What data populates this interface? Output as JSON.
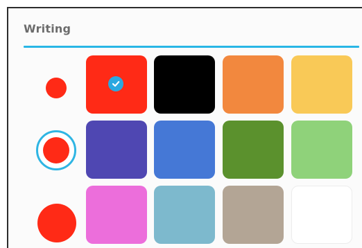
{
  "panel": {
    "title": "Writing"
  },
  "colors": {
    "accent": "#29b6e6",
    "selected_brush": "#ff2a16"
  },
  "brush_sizes": [
    {
      "name": "small",
      "selected": false
    },
    {
      "name": "medium",
      "selected": true
    },
    {
      "name": "large",
      "selected": false
    }
  ],
  "swatches": [
    {
      "name": "red",
      "color": "#ff2a16",
      "selected": true
    },
    {
      "name": "black",
      "color": "#000000",
      "selected": false
    },
    {
      "name": "orange",
      "color": "#f2883e",
      "selected": false
    },
    {
      "name": "yellow",
      "color": "#f9c957",
      "selected": false
    },
    {
      "name": "indigo",
      "color": "#4f47b2",
      "selected": false
    },
    {
      "name": "blue",
      "color": "#4578d6",
      "selected": false
    },
    {
      "name": "green",
      "color": "#5b912d",
      "selected": false
    },
    {
      "name": "light-green",
      "color": "#8fd27a",
      "selected": false
    },
    {
      "name": "pink",
      "color": "#ec6edb",
      "selected": false
    },
    {
      "name": "light-blue",
      "color": "#7db9cd",
      "selected": false
    },
    {
      "name": "taupe",
      "color": "#b3a595",
      "selected": false
    },
    {
      "name": "white",
      "color": "#ffffff",
      "selected": false
    }
  ],
  "icons": {
    "selected_check": "check-circle-icon"
  }
}
